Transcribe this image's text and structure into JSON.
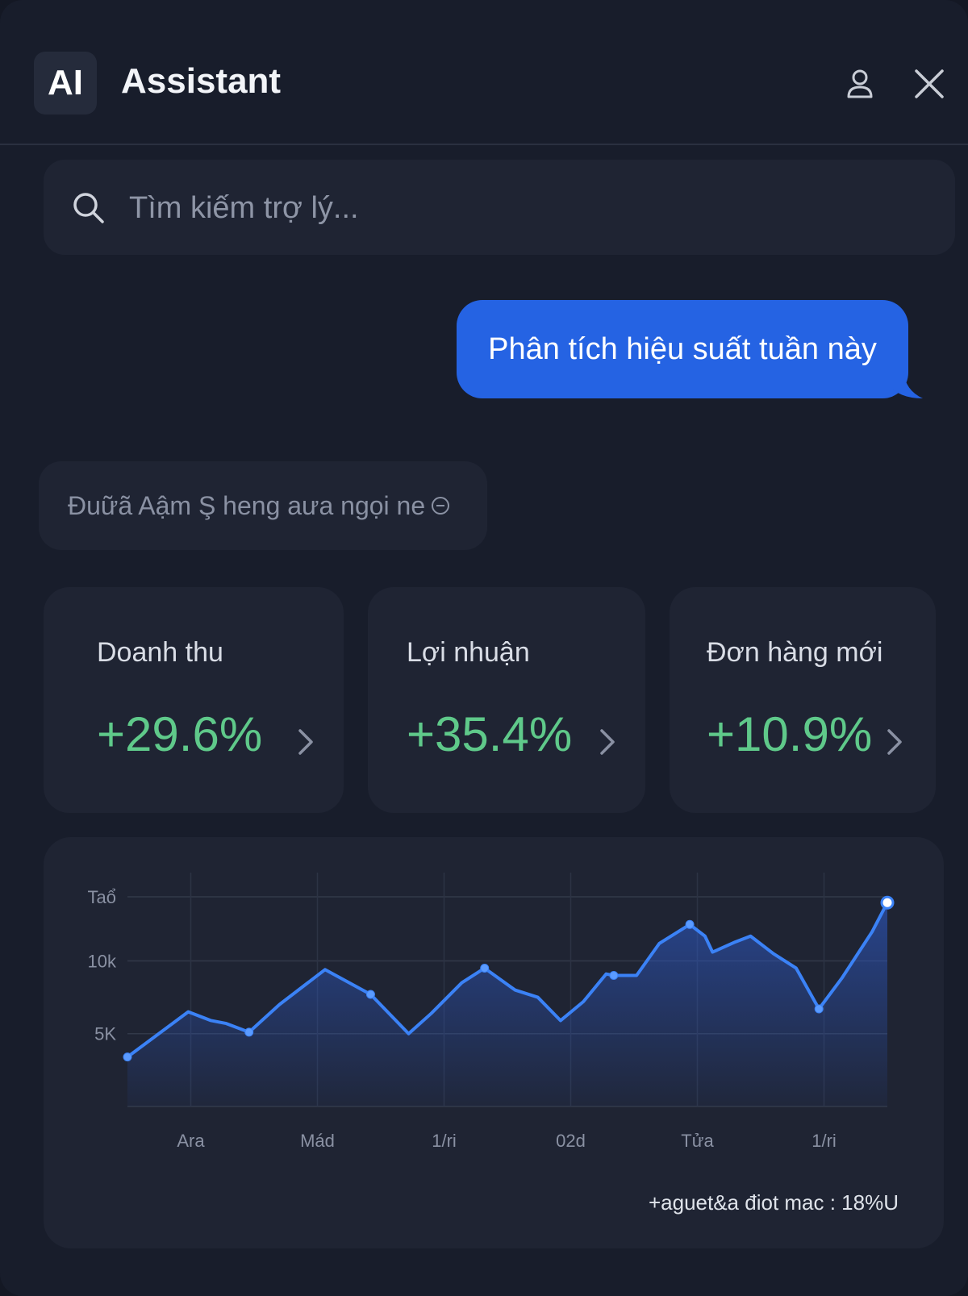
{
  "header": {
    "logo_text": "AI",
    "title": "Assistant",
    "icons": [
      "user-icon",
      "close-icon"
    ]
  },
  "search": {
    "placeholder": "Tìm kiếm trợ lý...",
    "value": ""
  },
  "chat": {
    "user_message": "Phân tích hiệu suất tuần này",
    "assistant_message": "Đuữã Aậm Ş heng aưa ngọi ne"
  },
  "metrics": [
    {
      "label": "Doanh thu",
      "value": "+29.6%"
    },
    {
      "label": "Lợi nhuận",
      "value": "+35.4%"
    },
    {
      "label": "Đơn hàng mới",
      "value": "+10.9%"
    }
  ],
  "colors": {
    "accent": "#2563e3",
    "positive": "#5fc98a",
    "line": "#3b82f6",
    "background": "#181d2b",
    "card": "#1f2433"
  },
  "chart_data": {
    "type": "area",
    "y_tick_labels": [
      "Taổ",
      "10k",
      "5K"
    ],
    "y_tick_values": [
      14400,
      10000,
      5000
    ],
    "ylim": [
      0,
      14400
    ],
    "x_tick_labels": [
      "Ara",
      "Mád",
      "1/ri",
      "02d",
      "Tửa",
      "1/ri"
    ],
    "x": [
      0,
      8,
      11,
      13,
      16,
      20,
      26,
      32,
      37,
      40,
      44,
      47,
      51,
      54,
      57,
      60,
      63,
      64,
      67,
      70,
      74,
      76,
      77,
      80,
      82,
      85,
      88,
      91,
      94,
      98,
      100
    ],
    "y": [
      3400,
      6500,
      5900,
      5700,
      5100,
      7000,
      9400,
      7700,
      5000,
      6400,
      8500,
      9500,
      8000,
      7500,
      5900,
      7200,
      9100,
      9000,
      9000,
      11200,
      12500,
      11700,
      10600,
      11300,
      11700,
      10500,
      9500,
      6700,
      8800,
      12000,
      14000
    ],
    "footnote": "+aguet&a điot mac : 18%U",
    "grid": true
  }
}
